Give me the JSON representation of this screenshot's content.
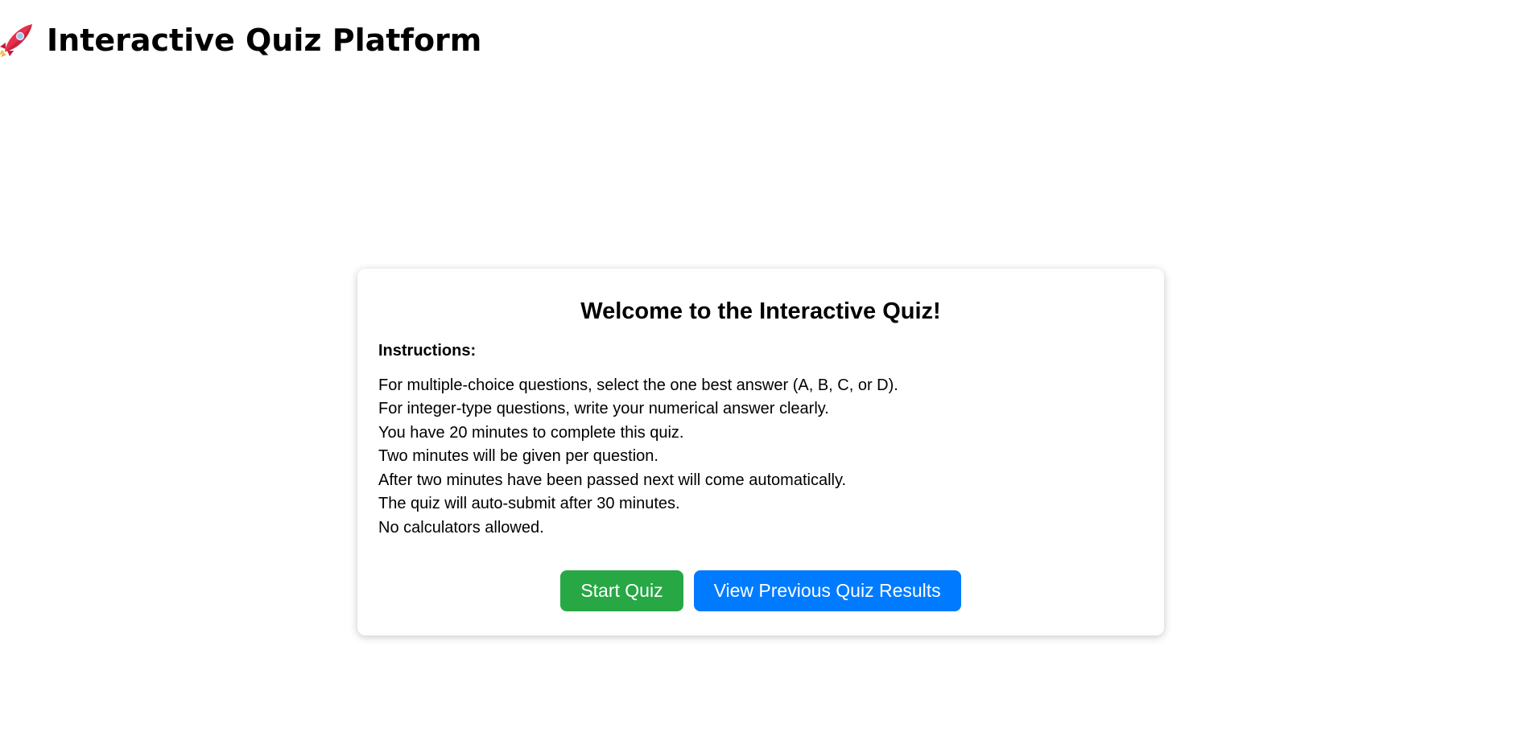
{
  "header": {
    "icon": "rocket-icon",
    "title": "Interactive Quiz Platform"
  },
  "card": {
    "title": "Welcome to the Interactive Quiz!",
    "instructions_label": "Instructions:",
    "instructions": [
      "For multiple-choice questions, select the one best answer (A, B, C, or D).",
      "For integer-type questions, write your numerical answer clearly.",
      "You have 20 minutes to complete this quiz.",
      "Two minutes will be given per question.",
      "After two minutes have been passed next will come automatically.",
      "The quiz will auto-submit after 30 minutes.",
      "No calculators allowed."
    ],
    "buttons": {
      "start_label": "Start Quiz",
      "results_label": "View Previous Quiz Results"
    }
  },
  "colors": {
    "start_button": "#28a745",
    "results_button": "#007bff",
    "rocket_body": "#e8304e",
    "rocket_window": "#9fc5e8"
  }
}
